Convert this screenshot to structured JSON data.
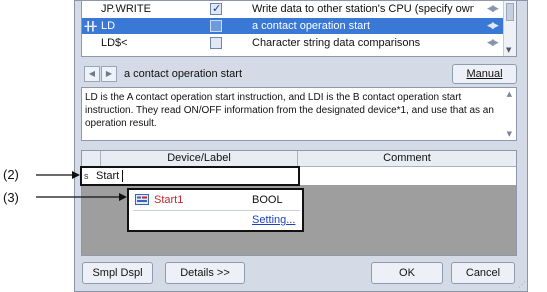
{
  "instructions": [
    {
      "symbol": "",
      "name": "JP.WRITE",
      "checked": true,
      "description": "Write data to other station's CPU (specify own ne",
      "selected": false
    },
    {
      "symbol": "-|‐|-",
      "name": "LD",
      "checked": false,
      "description": "a contact operation start",
      "selected": true
    },
    {
      "symbol": "",
      "name": "LD$<",
      "checked": false,
      "description": "Character string data comparisons",
      "selected": false
    }
  ],
  "nav": {
    "prev_glyph": "◀",
    "next_glyph": "▶",
    "current": "a contact operation start",
    "manual_label": "Manual"
  },
  "description": "LD is the A contact operation start instruction, and LDI is the B contact operation start instruction. They read ON/OFF information from the designated device*1, and use that as an operation result.",
  "grid": {
    "device_header": "Device/Label",
    "comment_header": "Comment"
  },
  "input": {
    "marker": "s",
    "value": "Start"
  },
  "suggestion": {
    "label": "Start1",
    "type": "BOOL",
    "setting_label": "Setting..."
  },
  "buttons": {
    "sample_display": "Smpl Dspl",
    "details": "Details >>",
    "ok": "OK",
    "cancel": "Cancel"
  },
  "callouts": {
    "input": "(2)",
    "suggestion": "(3)"
  },
  "colors": {
    "selection": "#3a78d6",
    "label_text": "#c6262e",
    "link": "#1f43b8"
  }
}
